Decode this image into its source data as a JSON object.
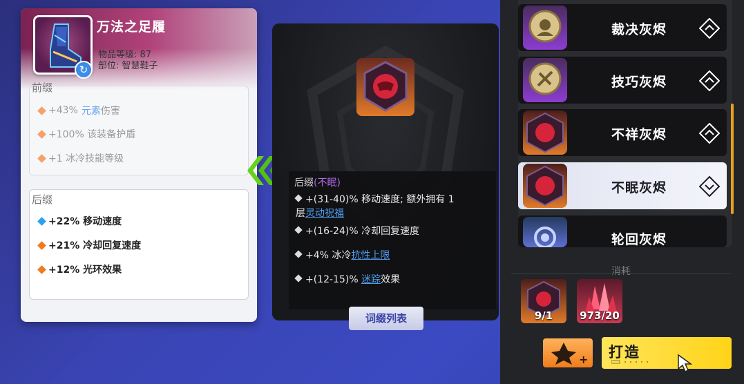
{
  "item": {
    "name": "万法之足履",
    "level": "物品等级: 87",
    "slot": "部位: 智慧鞋子",
    "prefix_title": "前缀",
    "prefixes": [
      {
        "value": "+43%",
        "hl": "元素",
        "rest": "伤害",
        "color": "#f3a36a"
      },
      {
        "value": "+100% 该装备护盾",
        "hl": "",
        "rest": "",
        "color": "#f3a36a"
      },
      {
        "value": "+1 冰冷技能等级",
        "hl": "",
        "rest": "",
        "color": "#f3a36a"
      }
    ],
    "suffix_title": "后缀",
    "suffixes": [
      {
        "text": "+22% 移动速度",
        "color": "#2aa2f0"
      },
      {
        "text": "+21% 冷却回复速度",
        "color": "#f07a1e"
      },
      {
        "text": "+12% 光环效果",
        "color": "#f07a1e"
      }
    ]
  },
  "tooltip": {
    "title": "后缀",
    "tag": "(不眠)",
    "rows": [
      {
        "pre": "+(31-40)% 移动速度; 额外拥有 1",
        "line2_pre": "层",
        "link": "灵动祝福",
        "post": ""
      },
      {
        "pre": "+(16-24)% 冷却回复速度",
        "line2_pre": "",
        "link": "",
        "post": ""
      },
      {
        "pre": "+4% 冰冷",
        "line2_pre": "",
        "link": "抗性上限",
        "post": ""
      },
      {
        "pre": "+(12-15)%",
        "line2_pre": "",
        "link": "迷踪",
        "post": "效果"
      }
    ]
  },
  "affix_list_button": "词缀列表",
  "embers": [
    {
      "name": "裁决灰烬",
      "thumb": "gold",
      "selected": false
    },
    {
      "name": "技巧灰烬",
      "thumb": "gold",
      "selected": false
    },
    {
      "name": "不祥灰烬",
      "thumb": "red",
      "selected": false
    },
    {
      "name": "不眠灰烬",
      "thumb": "red",
      "selected": true
    },
    {
      "name": "轮回灰烬",
      "thumb": "cyan",
      "selected": false
    }
  ],
  "consume": {
    "title": "消耗",
    "materials": [
      {
        "count": "9/1",
        "kind": "ember"
      },
      {
        "count": "973/20",
        "kind": "crystal"
      }
    ]
  },
  "craft_button": "打造",
  "colors": {
    "accent": "#ffd419",
    "link": "#4f9ff0",
    "scroll": "#e6a01e"
  }
}
